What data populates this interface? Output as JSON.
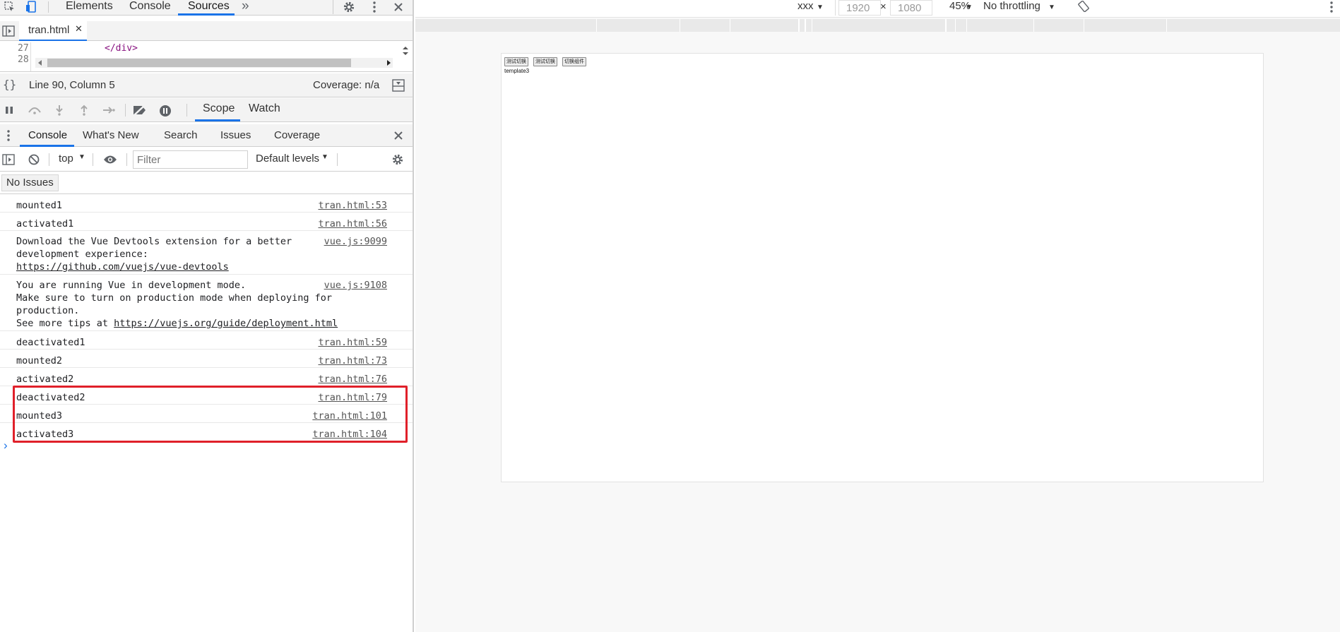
{
  "devtools": {
    "top_tabs": [
      "Elements",
      "Console",
      "Sources"
    ],
    "more_tabs_glyph": "»",
    "file_tab": {
      "name": "tran.html",
      "close_glyph": "✕"
    },
    "editor": {
      "lines": [
        {
          "num": "27",
          "code": "</div>"
        },
        {
          "num": "28",
          "code": ""
        }
      ]
    },
    "status": {
      "position": "Line 90, Column 5",
      "coverage": "Coverage: n/a"
    },
    "debugger_tabs": [
      "Scope",
      "Watch"
    ],
    "drawer_tabs": [
      "Console",
      "What's New",
      "Search",
      "Issues",
      "Coverage"
    ],
    "console_toolbar": {
      "context": "top",
      "filter_placeholder": "Filter",
      "levels": "Default levels"
    },
    "issues_button": "No Issues",
    "messages": [
      {
        "lines": [
          "mounted1"
        ],
        "source": "tran.html:53"
      },
      {
        "lines": [
          "activated1"
        ],
        "source": "tran.html:56"
      },
      {
        "lines": [
          "Download the Vue Devtools extension for a better",
          "development experience:"
        ],
        "link": "https://github.com/vuejs/vue-devtools",
        "source": "vue.js:9099"
      },
      {
        "lines": [
          "You are running Vue in development mode.",
          "Make sure to turn on production mode when deploying for",
          "production."
        ],
        "tail_prefix": "See more tips at ",
        "link": "https://vuejs.org/guide/deployment.html",
        "source": "vue.js:9108"
      },
      {
        "lines": [
          "deactivated1"
        ],
        "source": "tran.html:59"
      },
      {
        "lines": [
          "mounted2"
        ],
        "source": "tran.html:73"
      },
      {
        "lines": [
          "activated2"
        ],
        "source": "tran.html:76"
      },
      {
        "lines": [
          "deactivated2"
        ],
        "source": "tran.html:79"
      },
      {
        "lines": [
          "mounted3"
        ],
        "source": "tran.html:101"
      },
      {
        "lines": [
          "activated3"
        ],
        "source": "tran.html:104"
      }
    ],
    "prompt_glyph": "›",
    "highlight_color": "#e0202a"
  },
  "device_toolbar": {
    "device": "xxx",
    "width": "1920",
    "height": "1080",
    "times_glyph": "×",
    "zoom": "45%",
    "throttling": "No throttling"
  },
  "page": {
    "buttons": [
      "测试切换",
      "测试切换",
      "切换组件"
    ],
    "content": "template3"
  },
  "icons": {
    "inspect": "inspect-element-icon",
    "device": "device-toolbar-icon",
    "settings": "gear-icon",
    "more": "kebab-menu-icon",
    "close": "close-icon",
    "pretty_print": "pretty-print-icon",
    "pause": "pause-icon",
    "clear": "clear-console-icon",
    "eye": "live-expression-icon",
    "rotate": "rotate-icon"
  }
}
